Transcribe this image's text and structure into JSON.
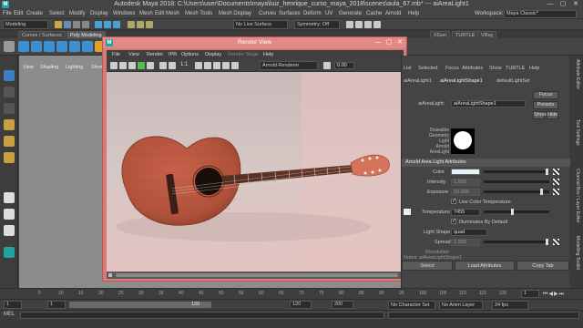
{
  "window": {
    "title": "Autodesk Maya 2018: C:\\Users\\user\\Documents\\maya\\luiz_henrique_curso_maya_2018\\scenes\\aula_67.mb*  ---  aiAreaLight1",
    "logo": "M",
    "minimize": "—",
    "maximize": "▢",
    "close": "✕"
  },
  "menubar": {
    "items": [
      "File",
      "Edit",
      "Create",
      "Select",
      "Modify",
      "Display",
      "Windows",
      "Mesh",
      "Edit Mesh",
      "Mesh Tools",
      "Mesh Display",
      "Curves",
      "Surfaces",
      "Deform",
      "UV",
      "Generate",
      "Cache",
      "Arnold",
      "Help"
    ],
    "workspace_label": "Workspace:",
    "workspace_value": "Maya Classic*"
  },
  "statusline": {
    "mode": "Modeling",
    "live_surface": "No Live Surface",
    "symmetry": "Symmetry: Off"
  },
  "shelf": {
    "tabs": [
      "Curves / Surfaces",
      "Poly Modeling",
      "Sculpting",
      "Rigging",
      "Animation",
      "Rendering",
      "FX",
      "FX Caching",
      "Custom",
      "Arnold",
      "Bifrost",
      "MASH",
      "Motion Graphics",
      "XGen",
      "TURTLE",
      "VRay"
    ],
    "active_tab": "Poly Modeling"
  },
  "viewport": {
    "menu": [
      "View",
      "Shading",
      "Lighting",
      "Show"
    ],
    "prefix_label": "V"
  },
  "render_view": {
    "title": "Render View",
    "logo": "M",
    "menu": [
      "File",
      "View",
      "Render",
      "IPR",
      "Options",
      "Display",
      "Render Stage",
      "Help"
    ],
    "ratio": "1:1",
    "renderer": "Arnold Renderer",
    "exposure": "0.00"
  },
  "attribute_editor": {
    "tabs_top": [
      "List",
      "Selected",
      "Focus",
      "Attributes",
      "Show",
      "TURTLE",
      "Help"
    ],
    "node_tabs": [
      "aiAreaLight1",
      "aiAreaLightShape1",
      "defaultLightSet"
    ],
    "node_label": "aiAreaLight:",
    "node_value": "aiAreaLightShape1",
    "focus_btn": "Focus",
    "presets_btn": "Presets",
    "show_btn": "Show",
    "hide_btn": "Hide",
    "preview_label": [
      "Drawable",
      "Geometry",
      "Light",
      "Arnold",
      "AreaLight"
    ],
    "section_title": "Arnold Area Light Attributes",
    "color_label": "Color",
    "intensity_label": "Intensity",
    "intensity_value": "1.000",
    "exposure_label": "Exposure",
    "exposure_value": "10.000",
    "use_color_temp_label": "Use Color Temperature",
    "temperature_label": "Temperature",
    "temperature_value": "7455",
    "illuminates_label": "Illuminates By Default",
    "light_shape_label": "Light Shape",
    "light_shape_value": "quad",
    "spread_label": "Spread",
    "spread_value": "1.000",
    "extra_label": "Resolution",
    "notes_label": "Notes: aiAreaLightShape1",
    "select_btn": "Select",
    "load_attrs_btn": "Load Attributes",
    "copy_tab_btn": "Copy Tab",
    "side_tabs": [
      "Attribute Editor",
      "Tool Settings",
      "Channel Box / Layer Editor",
      "Modelling Toolkit"
    ]
  },
  "timeslider": {
    "ticks": [
      "5",
      "10",
      "15",
      "20",
      "25",
      "30",
      "35",
      "40",
      "45",
      "50",
      "55",
      "60",
      "65",
      "70",
      "75",
      "80",
      "85",
      "90",
      "95",
      "100",
      "105",
      "110",
      "115",
      "120"
    ],
    "current": "1"
  },
  "range": {
    "start": "1",
    "inner_start": "1",
    "inner_end_label": "120",
    "end": "120",
    "anim_end": "200",
    "char_set": "No Character Set",
    "anim_layer": "No Anim Layer",
    "fps": "24 fps"
  },
  "cmdline": {
    "lang": "MEL"
  },
  "colors": {
    "maya_teal": "#1fa3a0",
    "render_view_frame": "#d87a76",
    "guitar_body": "#b4503a"
  }
}
